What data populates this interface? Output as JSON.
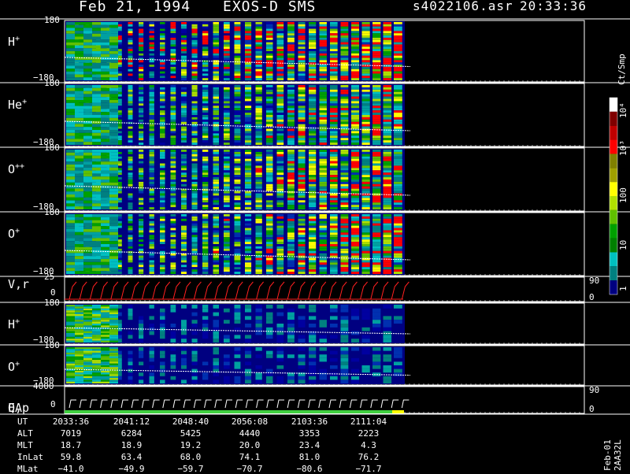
{
  "header": {
    "date": "Feb 21, 1994",
    "instrument": "EXOS-D SMS",
    "filename": "s4022106.asr",
    "time": "20:33:36"
  },
  "panels": [
    {
      "label": "H",
      "sup": "+",
      "ymax": "180",
      "ymin": "−180",
      "kind": "spectro",
      "intensity": 1.0
    },
    {
      "label": "He",
      "sup": "+",
      "ymax": "180",
      "ymin": "−180",
      "kind": "spectro",
      "intensity": 0.75
    },
    {
      "label": "O",
      "sup": "++",
      "ymax": "180",
      "ymin": "−180",
      "kind": "spectro",
      "intensity": 0.75
    },
    {
      "label": "O",
      "sup": "+",
      "ymax": "180",
      "ymin": "−180",
      "kind": "spectro",
      "intensity": 0.8
    },
    {
      "label": "V,r",
      "sup": "",
      "ymax": "25",
      "ymin": "0",
      "kind": "line",
      "right_top": "90",
      "right_bottom": "0"
    },
    {
      "label": "H",
      "sup": "+",
      "ymax": "180",
      "ymin": "−180",
      "kind": "sparse",
      "intensity": 0.3
    },
    {
      "label": "O",
      "sup": "+",
      "ymax": "180",
      "ymin": "−180",
      "kind": "sparse",
      "intensity": 0.25
    },
    {
      "label": "E,p",
      "label2": "QA",
      "sup": "",
      "ymax": "4000",
      "ymin": "0",
      "kind": "qa",
      "right_top": "90",
      "right_bottom": "0"
    }
  ],
  "colorbar": {
    "unit": "Ct/Smp",
    "ticks": [
      "10⁴",
      "10³",
      "100",
      "10",
      "1"
    ],
    "colors": [
      "#ffffff",
      "#800000",
      "#c00000",
      "#ff0000",
      "#808000",
      "#a0a000",
      "#ffff00",
      "#b0e000",
      "#60c000",
      "#00a000",
      "#008000",
      "#00c0c0",
      "#008080",
      "#000080"
    ]
  },
  "info_table": {
    "row_labels": [
      "UT",
      "ALT",
      "MLT",
      "InLat",
      "MLat"
    ],
    "columns": [
      [
        "2033:36",
        "7019",
        "18.7",
        "59.8",
        "−41.0"
      ],
      [
        "2041:12",
        "6284",
        "18.9",
        "63.4",
        "−49.9"
      ],
      [
        "2048:40",
        "5425",
        "19.2",
        "68.0",
        "−59.7"
      ],
      [
        "2056:08",
        "4440",
        "20.0",
        "74.1",
        "−70.7"
      ],
      [
        "2103:36",
        "3353",
        "23.4",
        "81.0",
        "−80.6"
      ],
      [
        "2111:04",
        "2223",
        "4.3",
        "76.2",
        "−71.7"
      ]
    ]
  },
  "footer_id": "Feb-01 2AA32L"
}
